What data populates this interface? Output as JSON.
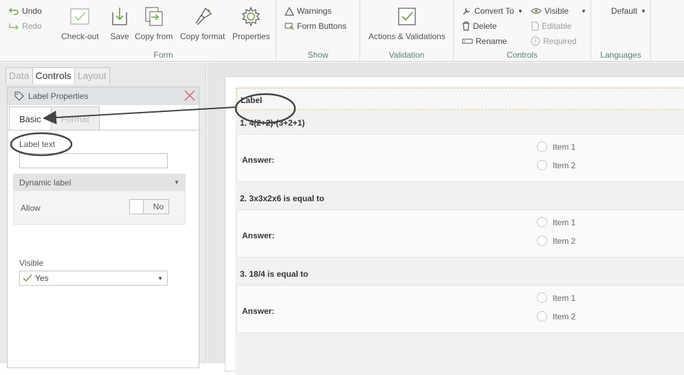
{
  "ribbon": {
    "undo": "Undo",
    "redo": "Redo",
    "form_group": {
      "label": "Form",
      "checkout": "Check-out",
      "save": "Save",
      "copy_from": "Copy from",
      "copy_format": "Copy format",
      "properties": "Properties"
    },
    "show_group": {
      "label": "Show",
      "warnings": "Warnings",
      "form_buttons": "Form Buttons"
    },
    "validation_group": {
      "label": "Validation",
      "actions": "Actions & Validations"
    },
    "controls_group": {
      "label": "Controls",
      "convert_to": "Convert To",
      "delete": "Delete",
      "rename": "Rename",
      "visible": "Visible",
      "editable": "Editable",
      "required": "Required"
    },
    "languages_group": {
      "label": "Languages",
      "current": "Default"
    }
  },
  "left_panel": {
    "tabs": [
      "Data",
      "Controls",
      "Layout"
    ],
    "active_tab": "Controls",
    "properties_title": "Label Properties",
    "subtabs": [
      "Basic",
      "Format"
    ],
    "label_text_label": "Label text",
    "label_text_value": "",
    "dynamic_label": "Dynamic label",
    "allow_label": "Allow",
    "allow_value": "No",
    "visible_label": "Visible",
    "visible_value": "Yes"
  },
  "form": {
    "label_control": "Label",
    "answer_label": "Answer:",
    "questions": [
      {
        "text": "1. 4(2+2)-(3+2+1)",
        "options": [
          "Item 1",
          "Item 2"
        ]
      },
      {
        "text": "2. 3x3x2x6 is equal to",
        "options": [
          "Item 1",
          "Item 2"
        ]
      },
      {
        "text": "3. 18/4 is equal to",
        "options": [
          "Item 1",
          "Item 2"
        ]
      }
    ]
  },
  "colors": {
    "accent_green": "#6a9f4a",
    "group_label": "#5a7d7d",
    "close_red": "#e05a5a",
    "label_outline": "#e6c86a"
  }
}
